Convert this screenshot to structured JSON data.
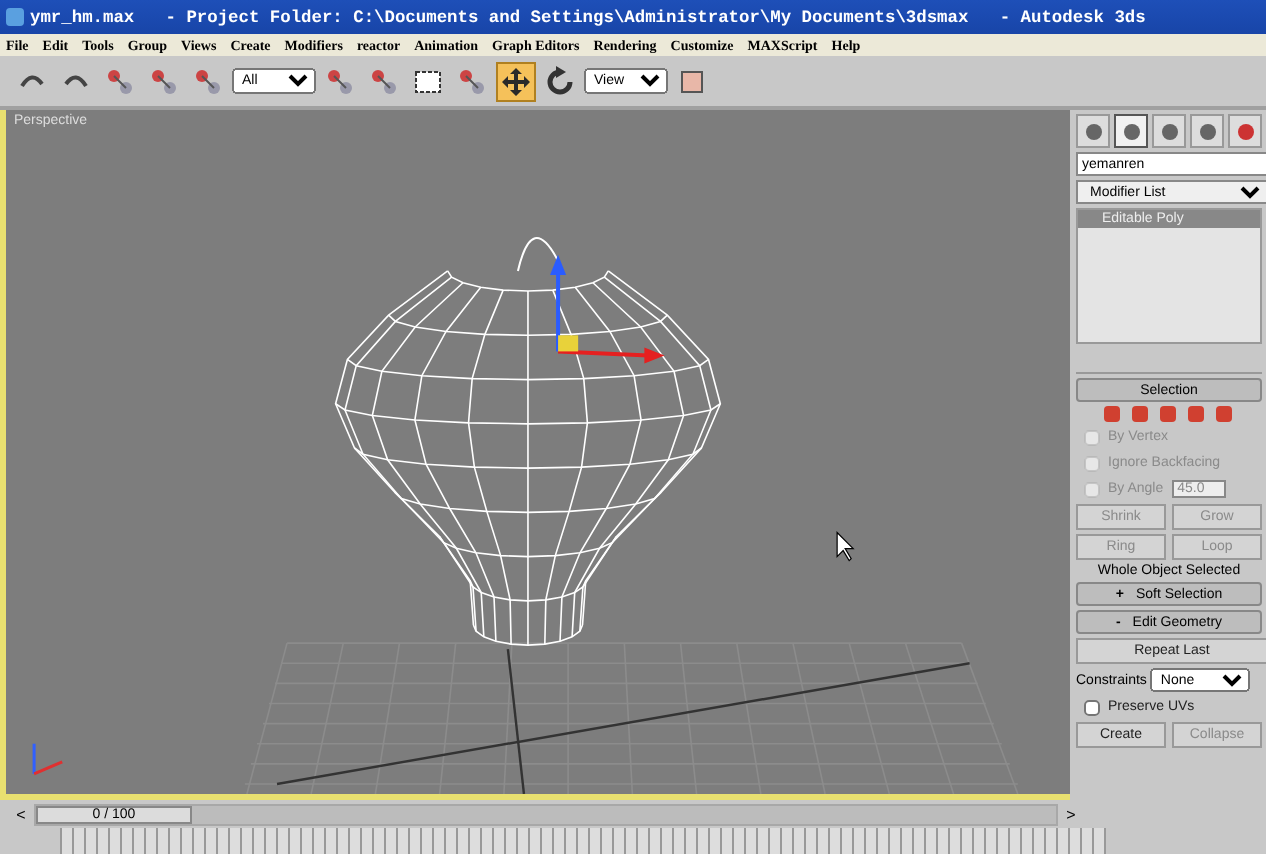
{
  "window": {
    "title": "ymr_hm.max   - Project Folder: C:\\Documents and Settings\\Administrator\\My Documents\\3dsmax   - Autodesk 3ds"
  },
  "menu": [
    "File",
    "Edit",
    "Tools",
    "Group",
    "Views",
    "Create",
    "Modifiers",
    "reactor",
    "Animation",
    "Graph Editors",
    "Rendering",
    "Customize",
    "MAXScript",
    "Help"
  ],
  "toolbar": {
    "selection_filter": "All",
    "reference_coordinate": "View",
    "tools": [
      {
        "selected": false
      },
      {
        "selected": false
      },
      {
        "selected": false
      },
      {
        "selected": false
      },
      {
        "selected": false
      },
      {
        "selected": false
      },
      {
        "selected": false
      },
      {
        "selected": false
      },
      {
        "selected": false
      },
      {
        "selected": true
      },
      {
        "selected": false
      },
      {
        "selected": false
      }
    ]
  },
  "viewport": {
    "label": "Perspective"
  },
  "command_panel": {
    "tabs": [
      {
        "selected": false
      },
      {
        "selected": true
      },
      {
        "selected": false
      },
      {
        "selected": false
      },
      {
        "selected": false
      }
    ],
    "object_name": "yemanren",
    "modifier_list": "Modifier List",
    "stack": [
      {
        "label": "Editable Poly",
        "selected": true
      }
    ],
    "selection": {
      "title": "Selection",
      "levels": [
        {
          "selected": false
        },
        {
          "selected": false
        },
        {
          "selected": false
        },
        {
          "selected": false
        },
        {
          "selected": false
        }
      ],
      "checkboxes": [
        {
          "label": "By Vertex",
          "checked": false,
          "disabled": true
        },
        {
          "label": "Ignore Backfacing",
          "checked": false,
          "disabled": true
        },
        {
          "label": "By Angle",
          "checked": false,
          "disabled": true
        }
      ],
      "angle": "45.0",
      "buttons": [
        {
          "label": "Shrink",
          "disabled": true
        },
        {
          "label": "Grow",
          "disabled": true
        },
        {
          "label": "Ring",
          "disabled": true
        },
        {
          "label": "Loop",
          "disabled": true
        }
      ],
      "status": "Whole Object Selected"
    },
    "soft_selection": {
      "title": "Soft Selection",
      "sign": "+"
    },
    "edit_geometry": {
      "title": "Edit Geometry",
      "sign": "-",
      "repeat_last": "Repeat Last",
      "constraints_label": "Constraints",
      "constraints": "None",
      "preserve_uvs": {
        "label": "Preserve UVs",
        "checked": false
      },
      "buttons": [
        {
          "label": "Create",
          "disabled": false
        },
        {
          "label": "Collapse",
          "disabled": true
        }
      ]
    }
  },
  "timeline": {
    "frame": "0 / 100",
    "level": 0,
    "prev": "<",
    "next": ">"
  }
}
